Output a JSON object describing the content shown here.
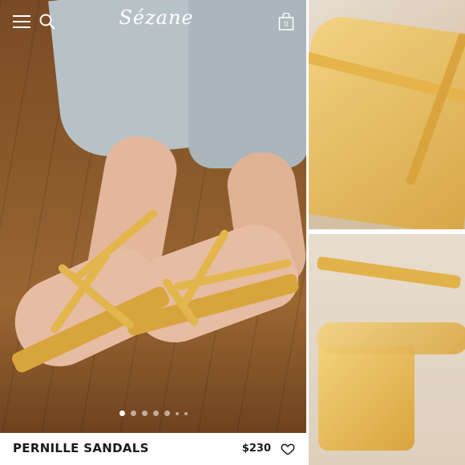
{
  "header": {
    "brand_logo_text": "Sézane",
    "menu_icon": "hamburger-menu-icon",
    "search_icon": "search-icon",
    "bag_icon": "shopping-bag-icon",
    "bag_count": "0"
  },
  "carousel": {
    "slide_count": 7,
    "active_index": 0
  },
  "product": {
    "name": "PERNILLE SANDALS",
    "price": "$230",
    "wishlist_icon": "heart-outline-icon"
  },
  "colors": {
    "text": "#1a1a1a",
    "accent_gold": "#d9a43e",
    "background": "#ffffff"
  }
}
